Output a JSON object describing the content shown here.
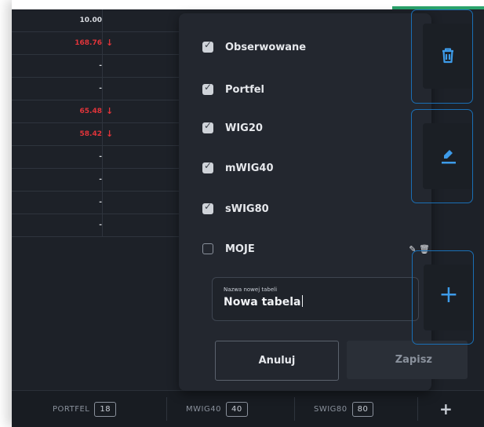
{
  "grid": {
    "rows": [
      {
        "value": "10.00",
        "negative": false,
        "arrow": ""
      },
      {
        "value": "168.76",
        "negative": true,
        "arrow": "↓"
      },
      {
        "value": "-",
        "negative": false,
        "arrow": ""
      },
      {
        "value": "-",
        "negative": false,
        "arrow": ""
      },
      {
        "value": "65.48",
        "negative": true,
        "arrow": "↓"
      },
      {
        "value": "58.42",
        "negative": true,
        "arrow": "↓"
      },
      {
        "value": "-",
        "negative": false,
        "arrow": ""
      },
      {
        "value": "-",
        "negative": false,
        "arrow": ""
      },
      {
        "value": "-",
        "negative": false,
        "arrow": ""
      },
      {
        "value": "-",
        "negative": false,
        "arrow": ""
      }
    ]
  },
  "dropdown": {
    "options": [
      {
        "label": "Obserwowane",
        "checked": true
      },
      {
        "label": "Portfel",
        "checked": true
      },
      {
        "label": "WIG20",
        "checked": true
      },
      {
        "label": "mWIG40",
        "checked": true
      },
      {
        "label": "sWIG80",
        "checked": true
      },
      {
        "label": "MOJE",
        "checked": false
      }
    ],
    "moje_tools": "✎ 🗑",
    "new_table": {
      "label": "Nazwa nowej tabeli",
      "value": "Nowa tabela"
    },
    "cancel_label": "Anuluj",
    "save_label": "Zapisz"
  },
  "side_buttons": {
    "delete_icon": "trash-icon",
    "edit_icon": "pencil-icon",
    "add_icon": "plus-icon",
    "add_symbol": "+"
  },
  "tabs": [
    {
      "label": "PORTFEL",
      "count": "18"
    },
    {
      "label": "MWIG40",
      "count": "40"
    },
    {
      "label": "SWIG80",
      "count": "80"
    }
  ],
  "tabs_add": "+",
  "colors": {
    "accent": "#3d9be9",
    "negative": "#e0343a",
    "background": "#1d2128"
  }
}
